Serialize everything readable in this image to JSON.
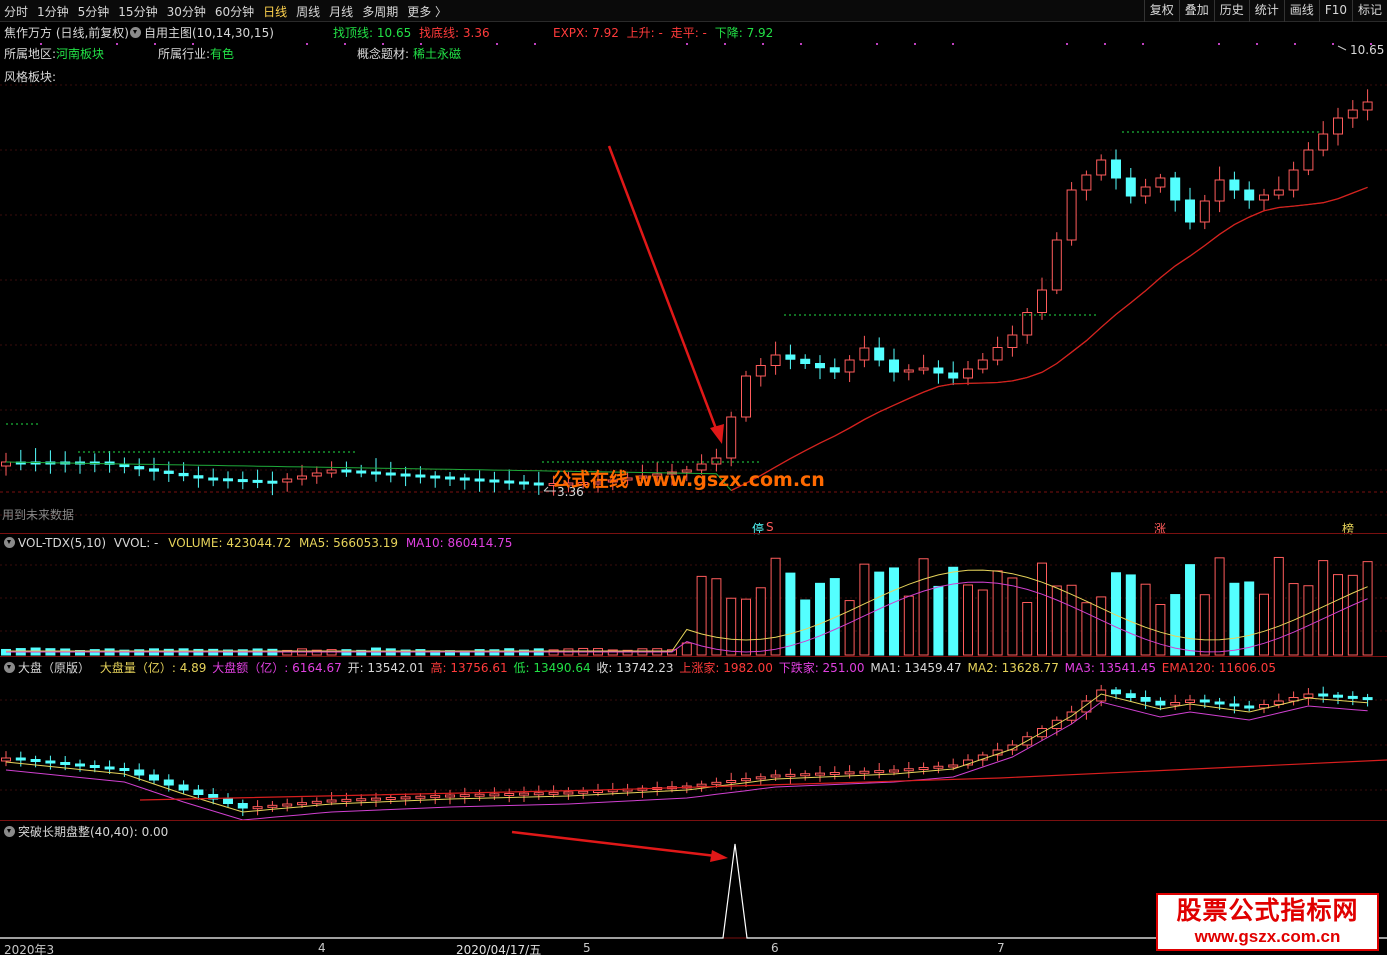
{
  "toolbar": {
    "periods": [
      "分时",
      "1分钟",
      "5分钟",
      "15分钟",
      "30分钟",
      "60分钟",
      "日线",
      "周线",
      "月线",
      "多周期",
      "更多 〉"
    ],
    "active_period": "日线",
    "tools": [
      "复权",
      "叠加",
      "历史",
      "统计",
      "画线",
      "F10",
      "标记"
    ]
  },
  "main": {
    "title": "焦作万方 (日线,前复权)",
    "indicator": "自用主图(10,14,30,15)",
    "top_line_label": "找顶线: 10.65",
    "bottom_line_label": "找底线: 3.36",
    "expx_label": "EXPX: 7.92",
    "rise_label": "上升: -",
    "flat_label": "走平: -",
    "fall_label": "下降: 7.92",
    "region_label": "所属地区:",
    "region_value": "河南板块",
    "industry_label": "所属行业:",
    "industry_value": "有色",
    "concept_label": "概念题材:",
    "concept_value": "稀土永磁",
    "style_label": "风格板块:",
    "future_note": "用到未来数据",
    "high_label": "10.65",
    "low_label": "3.36",
    "watermark_site": "公式在线  www.gszx.com.cn",
    "markers": [
      "停",
      "S",
      "涨",
      "榜"
    ]
  },
  "volume": {
    "title": "VOL-TDX(5,10)",
    "vvol": "VVOL: -",
    "volume": "VOLUME: 423044.72",
    "ma5": "MA5: 566053.19",
    "ma10": "MA10: 860414.75"
  },
  "market": {
    "title": "大盘（原版）",
    "vol": "大盘量（亿）: 4.89",
    "amt": "大盘额（亿）: 6164.67",
    "open": "开: 13542.01",
    "high": "高: 13756.61",
    "low": "低: 13490.64",
    "close": "收: 13742.23",
    "up": "上涨家: 1982.00",
    "down": "下跌家: 251.00",
    "ma1": "MA1: 13459.47",
    "ma2": "MA2: 13628.77",
    "ma3": "MA3: 13541.45",
    "ema": "EMA120: 11606.05"
  },
  "breakout": {
    "title": "突破长期盘整(40,40)",
    "value": ": 0.00"
  },
  "xaxis": {
    "labels": [
      "2020年3",
      "4",
      "2020/04/17/五",
      "5",
      "6",
      "7"
    ]
  },
  "watermark": {
    "big": "股票公式指标网",
    "url": "www.gszx.com.cn"
  },
  "colors": {
    "up": "#ff5c5c",
    "down": "#54ffff",
    "ma_red": "#d81e1e",
    "ma_yellow": "#e6d35a",
    "ma_magenta": "#d040d0",
    "dotted_green": "#22e046"
  }
}
